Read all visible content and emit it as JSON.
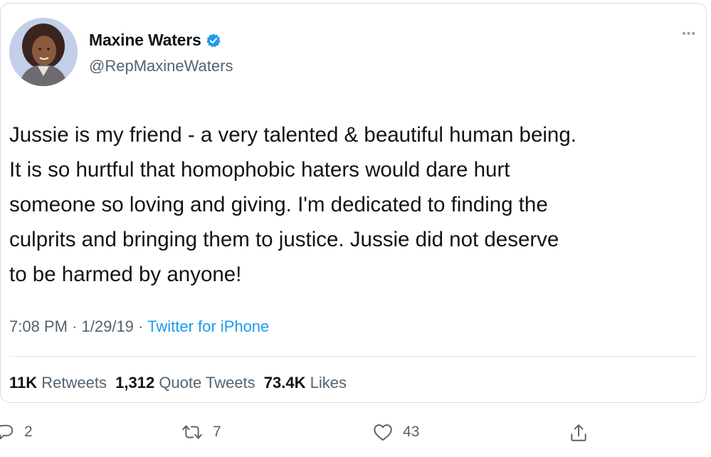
{
  "user": {
    "display_name": "Maxine Waters",
    "handle": "@RepMaxineWaters",
    "verified": true
  },
  "tweet": {
    "lines": [
      "Jussie is my friend - a very talented & beautiful human being.",
      "It is so hurtful that homophobic haters would dare hurt",
      "someone so loving and giving. I'm dedicated to finding the",
      "culprits and bringing them to justice. Jussie did not deserve",
      "to be harmed by anyone!"
    ],
    "time": "7:08 PM",
    "date": "1/29/19",
    "separator": "·",
    "source": "Twitter for iPhone"
  },
  "stats": {
    "retweets_count": "11K",
    "retweets_label": "Retweets",
    "quotes_count": "1,312",
    "quotes_label": "Quote Tweets",
    "likes_count": "73.4K",
    "likes_label": "Likes"
  },
  "actions": {
    "reply_count": "2",
    "retweet_count": "7",
    "like_count": "43"
  },
  "colors": {
    "accent": "#1d9bf0",
    "text": "#0f1419",
    "muted": "#536471",
    "border": "#d8dde2"
  },
  "icons": {
    "verified": "verified-badge-icon",
    "more": "more-options-icon",
    "reply": "reply-icon",
    "retweet": "retweet-icon",
    "like": "heart-icon",
    "share": "share-icon"
  }
}
